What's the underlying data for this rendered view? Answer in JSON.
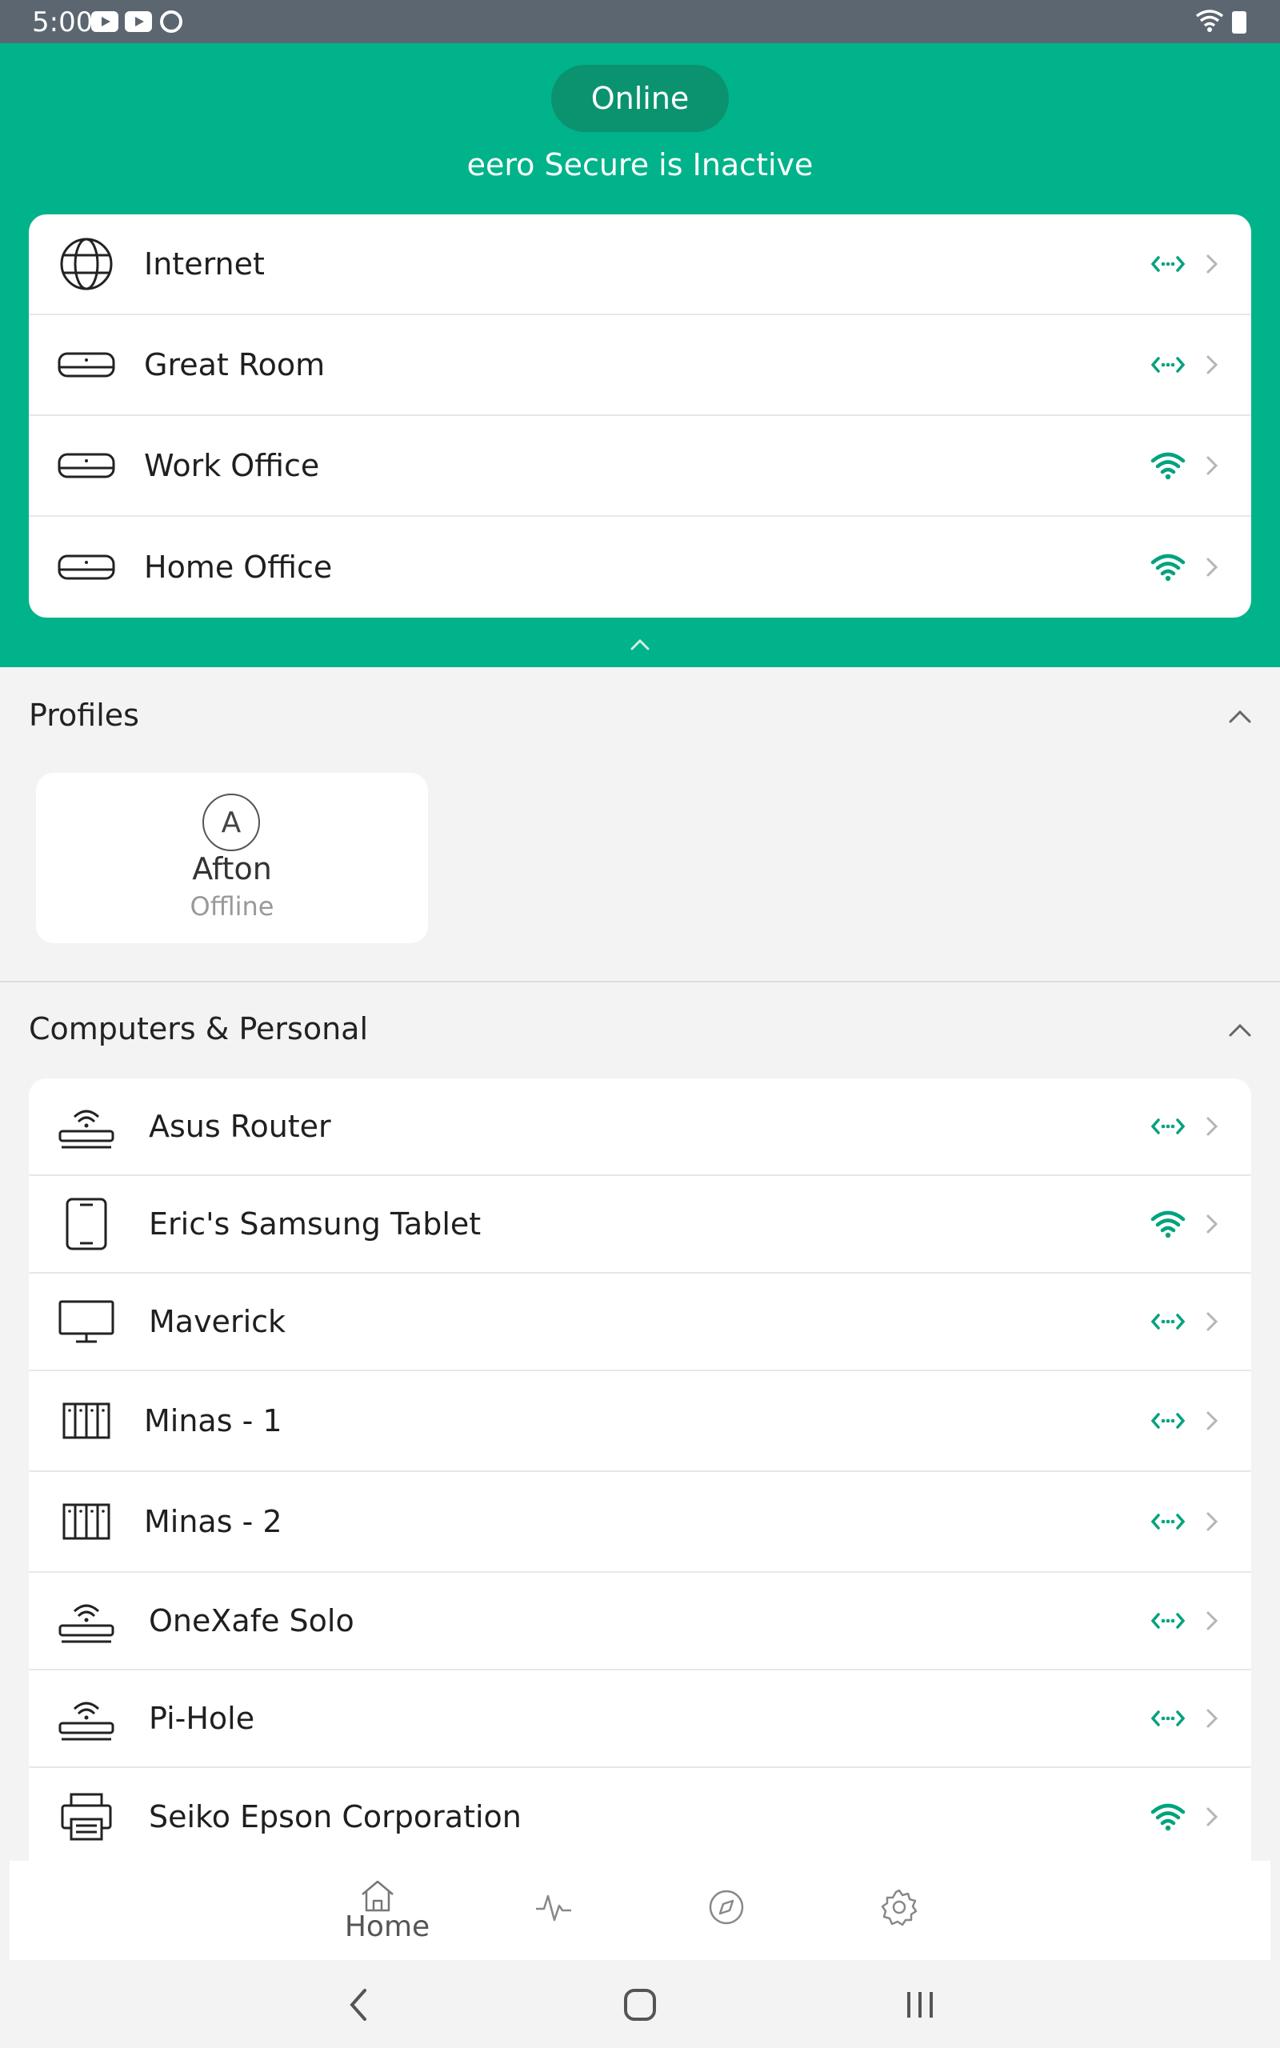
{
  "status_bar": {
    "time": "5:00"
  },
  "header": {
    "status_pill": "Online",
    "secure_text": "eero Secure is Inactive"
  },
  "network_nodes": [
    {
      "label": "Internet",
      "icon": "globe-icon",
      "status": "wired"
    },
    {
      "label": "Great Room",
      "icon": "eero-device-icon",
      "status": "wired"
    },
    {
      "label": "Work Office",
      "icon": "eero-device-icon",
      "status": "wifi"
    },
    {
      "label": "Home Office",
      "icon": "eero-device-icon",
      "status": "wifi"
    }
  ],
  "profiles": {
    "title": "Profiles",
    "items": [
      {
        "initial": "A",
        "name": "Afton",
        "status": "Offline"
      }
    ]
  },
  "devices": {
    "title": "Computers & Personal",
    "items": [
      {
        "label": "Asus Router",
        "icon": "router-icon",
        "status": "wired"
      },
      {
        "label": "Eric's Samsung Tablet",
        "icon": "tablet-icon",
        "status": "wifi"
      },
      {
        "label": "Maverick",
        "icon": "monitor-icon",
        "status": "wired"
      },
      {
        "label": "Minas - 1",
        "icon": "server-icon",
        "status": "wired"
      },
      {
        "label": "Minas - 2",
        "icon": "server-icon",
        "status": "wired"
      },
      {
        "label": "OneXafe Solo",
        "icon": "router-icon",
        "status": "wired"
      },
      {
        "label": "Pi-Hole",
        "icon": "router-icon",
        "status": "wired"
      },
      {
        "label": "Seiko Epson Corporation",
        "icon": "printer-icon",
        "status": "wifi"
      }
    ]
  },
  "bottom_nav": {
    "home_label": "Home",
    "items": [
      "home-icon",
      "activity-icon",
      "discover-icon",
      "settings-icon"
    ]
  },
  "colors": {
    "accent": "#00b38a",
    "accent_dark": "#0b936f",
    "status_bar": "#5b6670"
  }
}
